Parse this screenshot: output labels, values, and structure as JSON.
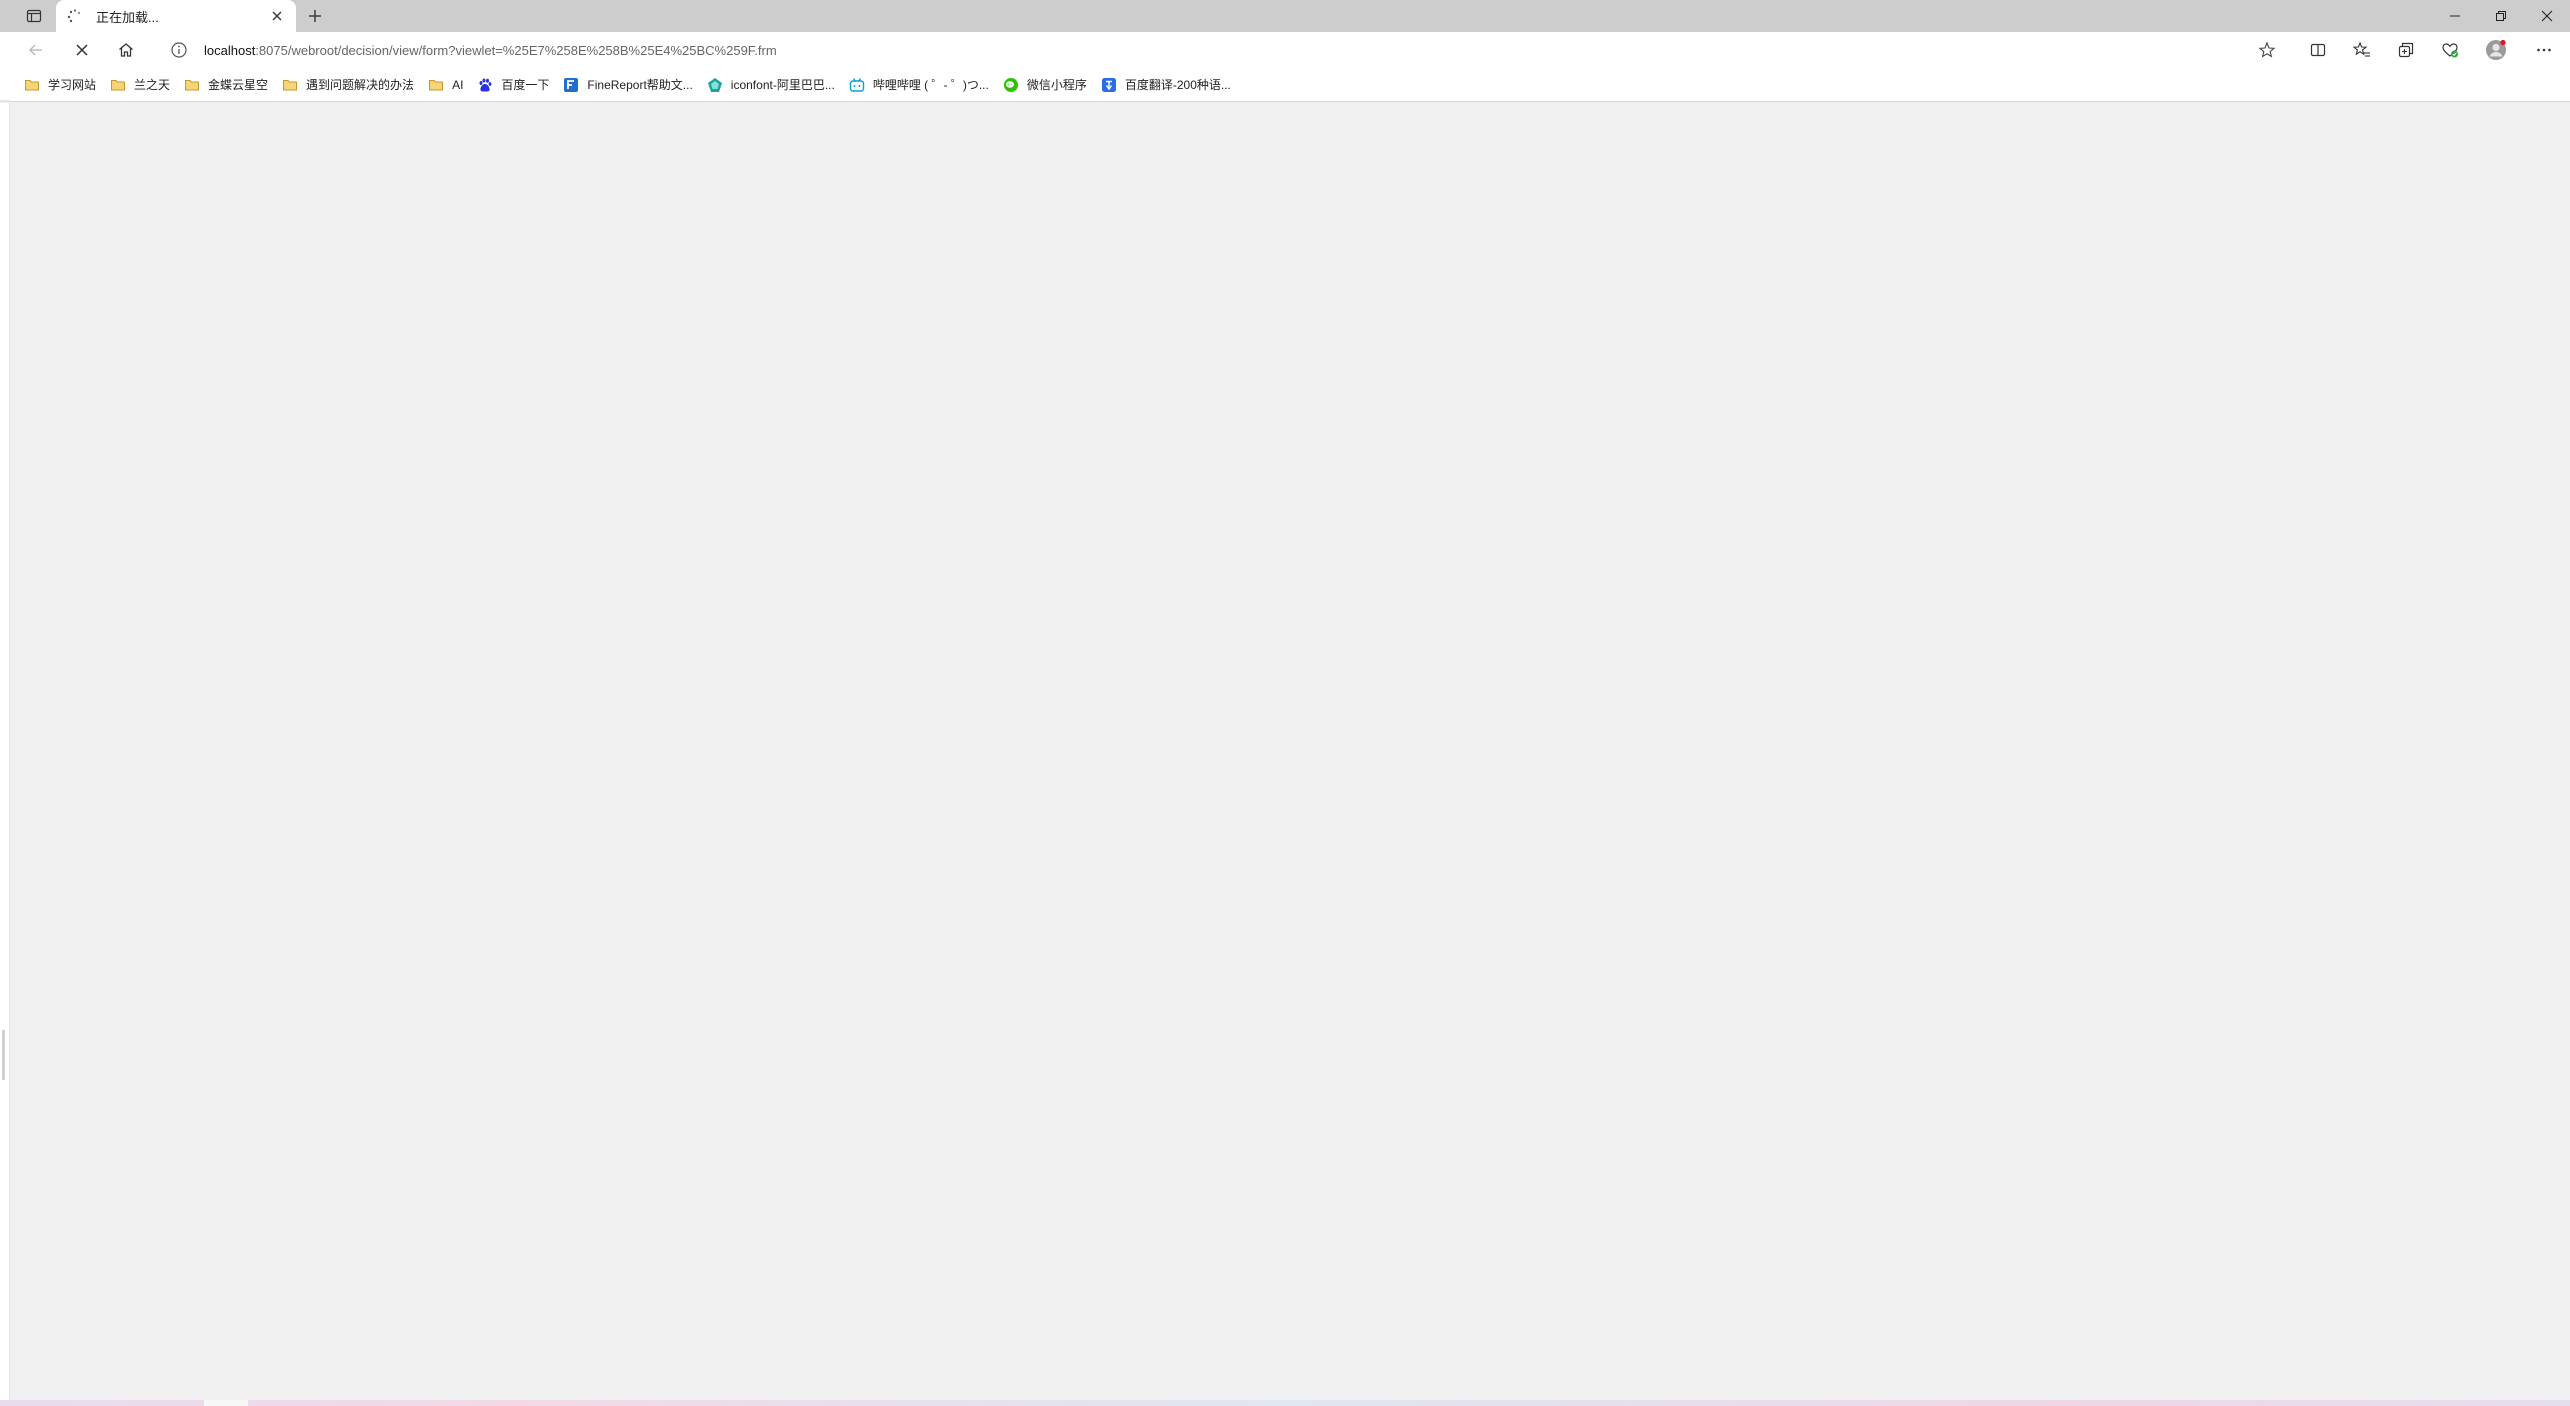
{
  "tab": {
    "title": "正在加载...",
    "loading": true
  },
  "address_bar": {
    "host": "localhost",
    "path": ":8075/webroot/decision/view/form?viewlet=%25E7%258E%258B%25E4%25BC%259F.frm"
  },
  "bookmarks": [
    {
      "label": "学习网站",
      "icon": "folder-icon"
    },
    {
      "label": "兰之天",
      "icon": "folder-icon"
    },
    {
      "label": "金蝶云星空",
      "icon": "folder-icon"
    },
    {
      "label": "遇到问题解决的办法",
      "icon": "folder-icon"
    },
    {
      "label": "AI",
      "icon": "folder-icon"
    },
    {
      "label": "百度一下",
      "icon": "baidu-icon"
    },
    {
      "label": "FineReport帮助文...",
      "icon": "finereport-icon"
    },
    {
      "label": "iconfont-阿里巴巴...",
      "icon": "iconfont-icon"
    },
    {
      "label": "哔哩哔哩 ( ゜- ゜)つ...",
      "icon": "bilibili-icon"
    },
    {
      "label": "微信小程序",
      "icon": "wechat-icon"
    },
    {
      "label": "百度翻译-200种语...",
      "icon": "baidu-translate-icon"
    }
  ],
  "colors": {
    "tabstrip": "#cdcdcd",
    "toolbar": "#ffffff",
    "content": "#f0f0f0",
    "folder": "#f2c14e",
    "wechat": "#2dc100",
    "baidu": "#2932e1",
    "bilibili": "#00a1d6"
  }
}
